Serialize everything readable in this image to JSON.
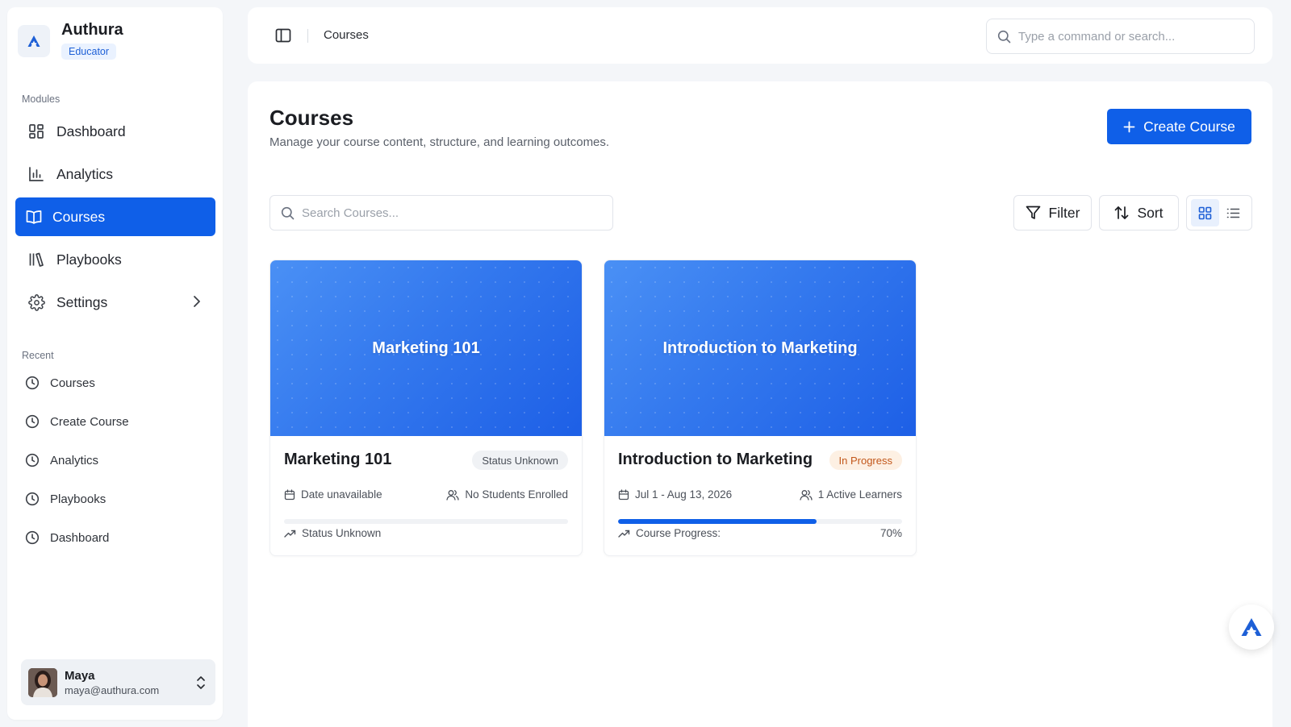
{
  "app": {
    "name": "Authura",
    "role": "Educator"
  },
  "sidebar": {
    "modules_label": "Modules",
    "items": [
      {
        "label": "Dashboard",
        "icon": "grid-icon"
      },
      {
        "label": "Analytics",
        "icon": "bar-chart-icon"
      },
      {
        "label": "Courses",
        "icon": "book-open-icon",
        "active": true
      },
      {
        "label": "Playbooks",
        "icon": "library-icon"
      },
      {
        "label": "Settings",
        "icon": "gear-icon"
      }
    ],
    "recent_label": "Recent",
    "recent": [
      {
        "label": "Courses"
      },
      {
        "label": "Create Course"
      },
      {
        "label": "Analytics"
      },
      {
        "label": "Playbooks"
      },
      {
        "label": "Dashboard"
      }
    ]
  },
  "user": {
    "name": "Maya",
    "email": "maya@authura.com"
  },
  "topbar": {
    "breadcrumb": "Courses",
    "search_placeholder": "Type a command or search..."
  },
  "main": {
    "title": "Courses",
    "subtitle": "Manage your course content, structure, and learning outcomes.",
    "create_label": "Create Course",
    "search_placeholder": "Search Courses...",
    "filter_label": "Filter",
    "sort_label": "Sort",
    "view": "grid"
  },
  "courses": [
    {
      "banner_title": "Marketing 101",
      "title": "Marketing 101",
      "status": "Status Unknown",
      "date": "Date unavailable",
      "students": "No Students Enrolled",
      "footer_label": "Status Unknown",
      "footer_value": "",
      "progress": 0
    },
    {
      "banner_title": "Introduction to Marketing",
      "title": "Introduction to Marketing",
      "status": "In Progress",
      "date": "Jul 1 - Aug 13, 2026",
      "students": "1 Active Learners",
      "footer_label": "Course Progress:",
      "footer_value": "70%",
      "progress": 0.7
    }
  ],
  "colors": {
    "accent": "#0f5fe8",
    "badge_progress_text": "#c2571a",
    "badge_progress_bg": "#fdf0e3"
  }
}
